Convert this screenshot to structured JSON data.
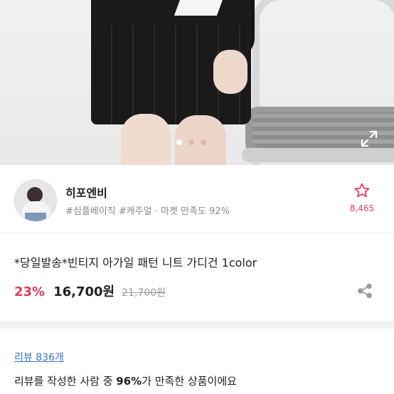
{
  "hero": {
    "carousel": {
      "current_page": 1,
      "total_pages": 3
    },
    "icons": {
      "expand": "expand-icon"
    }
  },
  "seller": {
    "name": "히포엔비",
    "tags": "#심플베이직 #캐주얼 · 마켓 만족도 92%",
    "favorite_count": "8,465",
    "favorite_icon": "star-outline-icon",
    "accent_color": "#e53e5e"
  },
  "product": {
    "title": "*당일발송*빈티지 아가일  패턴 니트 가디건 1color",
    "discount": "23%",
    "price": "16,700원",
    "original_price": "21,700원",
    "share_icon": "share-icon",
    "discount_color": "#e33b58"
  },
  "review": {
    "link_label": "리뷰 836개",
    "summary_prefix": "리뷰를 작성한 사람 중 ",
    "summary_percent": "96%",
    "summary_suffix": "가 만족한 상품이에요",
    "link_color": "#3a73c4"
  }
}
